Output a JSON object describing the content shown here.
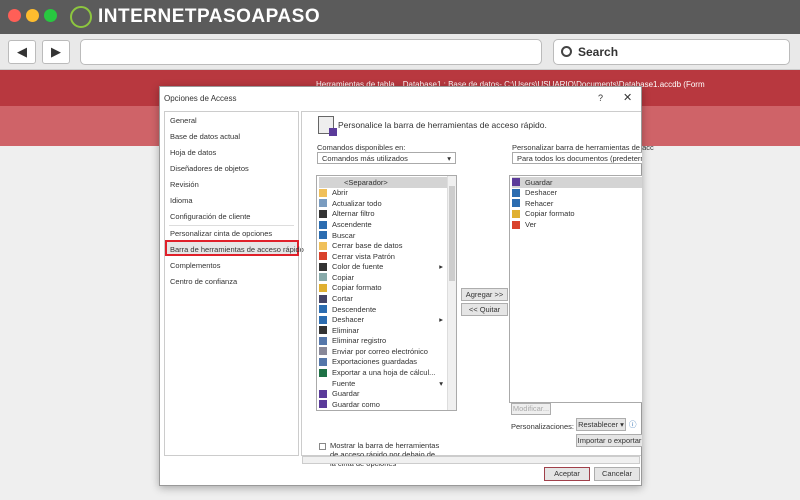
{
  "browser": {
    "logo_text": "INTERNETPASOAPASO",
    "search_label": "Search",
    "back_icon": "◀",
    "forward_icon": "▶",
    "dots": [
      "#ff5f57",
      "#febc2e",
      "#28c840"
    ]
  },
  "app": {
    "context_tab": "Herramientas de tabla",
    "title": "Database1 : Base de datos- C:\\Users\\USUARIO\\Documents\\Database1.accdb (Form"
  },
  "dialog": {
    "title": "Opciones de Access",
    "help": "?",
    "close": "✕",
    "nav": [
      "General",
      "Base de datos actual",
      "Hoja de datos",
      "Diseñadores de objetos",
      "Revisión",
      "Idioma",
      "Configuración de cliente",
      "Personalizar cinta de opciones",
      "Barra de herramientas de acceso rápido",
      "Complementos",
      "Centro de confianza"
    ],
    "heading": "Personalice la barra de herramientas de acceso rápido.",
    "commands_label": "Comandos disponibles en:",
    "commands_value": "Comandos más utilizados",
    "customize_label": "Personalizar barra de herramientas de acc",
    "customize_value": "Para todos los documentos (predetermi",
    "commands": [
      {
        "label": "<Separador>",
        "icon": "none",
        "color": "#ccc"
      },
      {
        "label": "Abrir",
        "icon": "folder",
        "color": "#f0c05a"
      },
      {
        "label": "Actualizar todo",
        "icon": "refresh",
        "color": "#7a9cc0"
      },
      {
        "label": "Alternar filtro",
        "icon": "filter",
        "color": "#333"
      },
      {
        "label": "Ascendente",
        "icon": "sort-asc",
        "color": "#2b6cb0"
      },
      {
        "label": "Buscar",
        "icon": "search",
        "color": "#2b6cb0"
      },
      {
        "label": "Cerrar base de datos",
        "icon": "folder",
        "color": "#f0c05a"
      },
      {
        "label": "Cerrar vista Patrón",
        "icon": "close-red",
        "color": "#d9412b"
      },
      {
        "label": "Color de fuente",
        "icon": "font-color",
        "color": "#333",
        "sub": "▸"
      },
      {
        "label": "Copiar",
        "icon": "copy",
        "color": "#8aa"
      },
      {
        "label": "Copiar formato",
        "icon": "brush",
        "color": "#e0b030"
      },
      {
        "label": "Cortar",
        "icon": "scissors",
        "color": "#446"
      },
      {
        "label": "Descendente",
        "icon": "sort-desc",
        "color": "#2b6cb0"
      },
      {
        "label": "Deshacer",
        "icon": "undo",
        "color": "#2b6cb0",
        "sub": "▸"
      },
      {
        "label": "Eliminar",
        "icon": "x",
        "color": "#333"
      },
      {
        "label": "Eliminar registro",
        "icon": "delete-record",
        "color": "#5577aa"
      },
      {
        "label": "Enviar por correo electrónico",
        "icon": "mail",
        "color": "#889"
      },
      {
        "label": "Exportaciones guardadas",
        "icon": "export",
        "color": "#5577aa"
      },
      {
        "label": "Exportar a una hoja de cálcul...",
        "icon": "excel",
        "color": "#1e7145"
      },
      {
        "label": "Fuente",
        "icon": "none",
        "color": "#fff",
        "sub": "▾"
      },
      {
        "label": "Guardar",
        "icon": "save",
        "color": "#5b3b9a"
      },
      {
        "label": "Guardar como",
        "icon": "save-as",
        "color": "#5b3b9a"
      }
    ],
    "toolbar_items": [
      {
        "label": "Guardar",
        "icon": "save",
        "color": "#5b3b9a"
      },
      {
        "label": "Deshacer",
        "icon": "undo",
        "color": "#2b6cb0"
      },
      {
        "label": "Rehacer",
        "icon": "redo",
        "color": "#2b6cb0"
      },
      {
        "label": "Copiar formato",
        "icon": "brush",
        "color": "#e0b030"
      },
      {
        "label": "Ver",
        "icon": "view",
        "color": "#d9412b"
      }
    ],
    "add_button": "Agregar >>",
    "remove_button": "<< Quitar",
    "show_below": "Mostrar la barra de herramientas de acceso rápido por debajo de la cinta de opciones",
    "modify_button": "Modificar...",
    "customizations_label": "Personalizaciones:",
    "reset_button": "Restablecer ▾",
    "import_button": "Importar o exportar",
    "ok_button": "Aceptar",
    "cancel_button": "Cancelar"
  }
}
